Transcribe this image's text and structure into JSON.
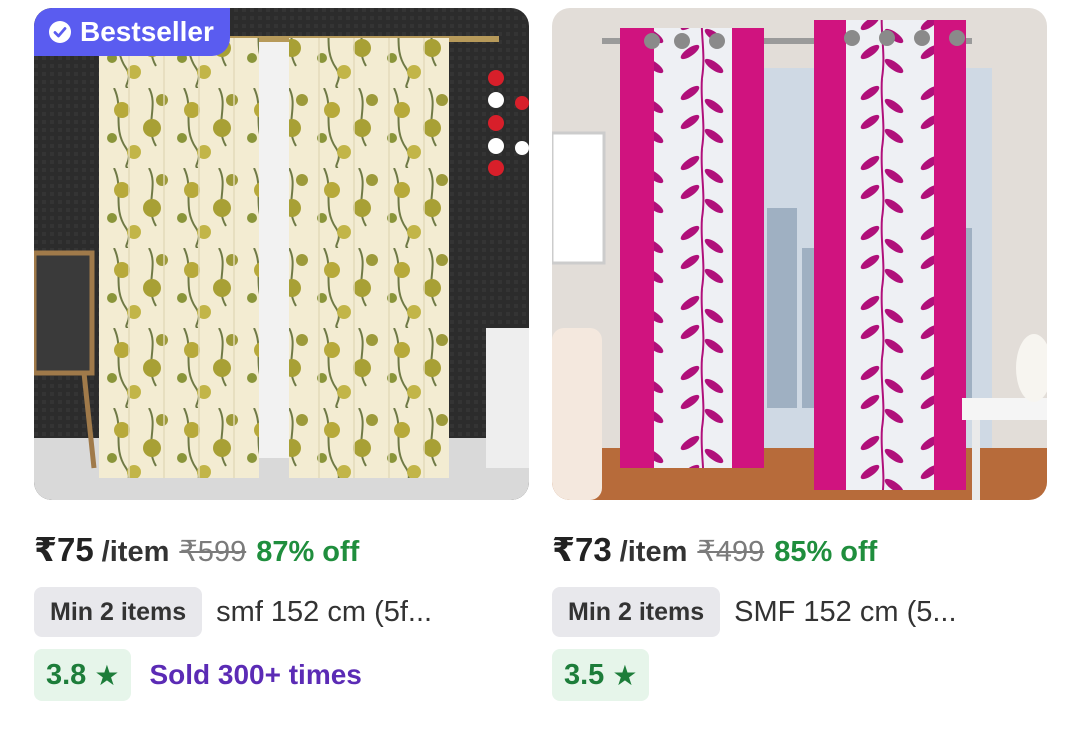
{
  "products": [
    {
      "badge": "Bestseller",
      "price": "₹75",
      "unit": "/item",
      "mrp": "₹599",
      "discount": "87% off",
      "min_qty": "Min 2 items",
      "title": "smf 152 cm (5f...",
      "rating": "3.8",
      "star": "★",
      "sold": "Sold 300+ times"
    },
    {
      "price": "₹73",
      "unit": "/item",
      "mrp": "₹499",
      "discount": "85% off",
      "min_qty": "Min 2 items",
      "title": "SMF 152 cm (5...",
      "rating": "3.5",
      "star": "★"
    }
  ],
  "colors": {
    "badge_bg": "#5a5cf0",
    "discount_green": "#1f8e3d",
    "rating_bg": "#e6f5ea",
    "sold_purple": "#5b2bb5",
    "curtain_magenta": "#d0137f"
  }
}
